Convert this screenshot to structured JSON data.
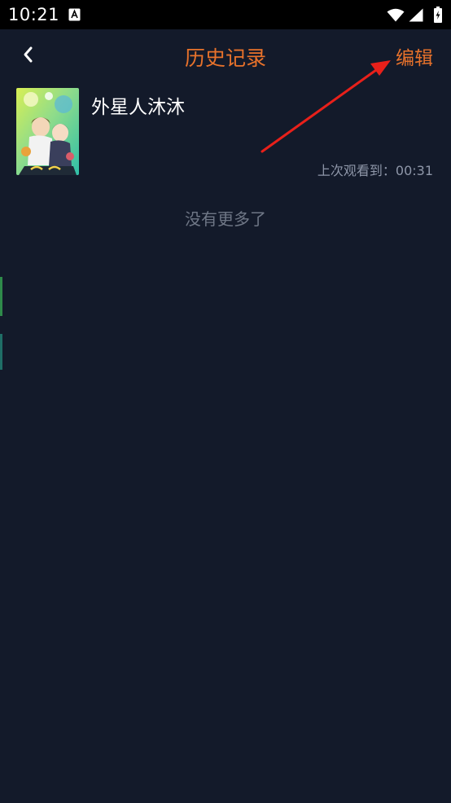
{
  "status_bar": {
    "time": "10:21",
    "app_icon": "a-letter-app-icon",
    "wifi_icon": "wifi-icon",
    "signal_icon": "cellular-signal-icon",
    "battery_icon": "battery-charging-icon"
  },
  "header": {
    "back_icon": "chevron-left-icon",
    "title": "历史记录",
    "edit_label": "编辑"
  },
  "history": {
    "items": [
      {
        "title": "外星人沐沐",
        "last_watched_label": "上次观看到：",
        "last_watched_time": "00:31",
        "thumbnail_icon": "anime-poster-thumbnail"
      }
    ],
    "end_text": "没有更多了"
  },
  "colors": {
    "background": "#131a2a",
    "accent": "#e8722b",
    "annotation_arrow": "#e8201a",
    "secondary_text": "#8e96a8",
    "muted_text": "#6f7786"
  }
}
